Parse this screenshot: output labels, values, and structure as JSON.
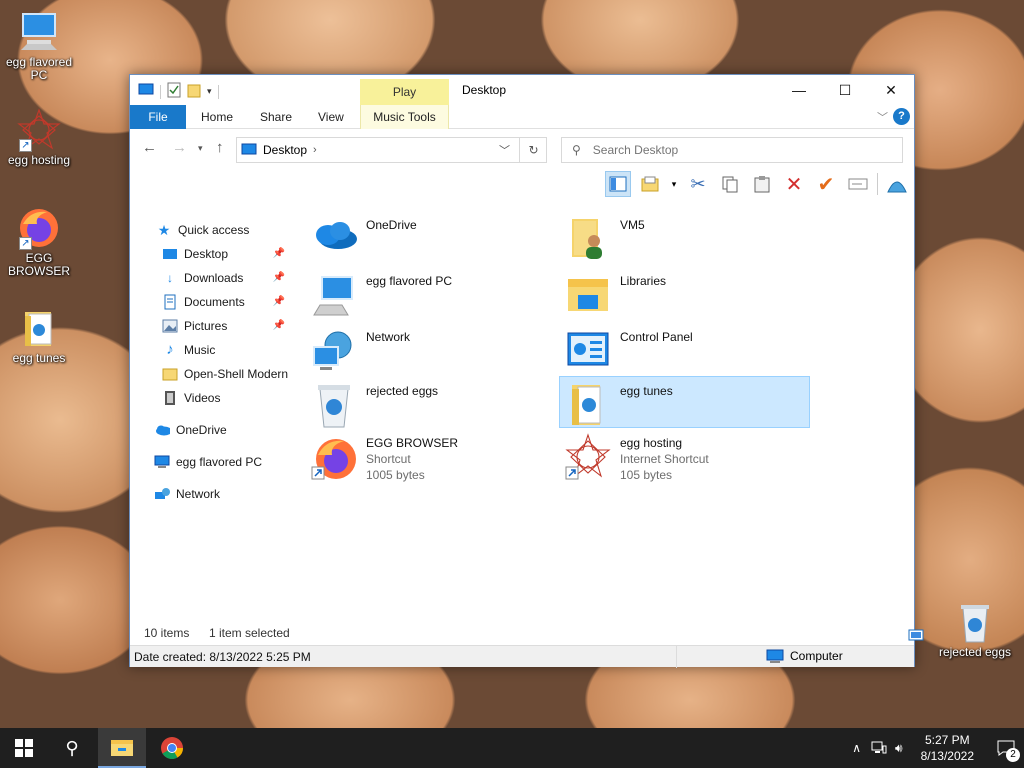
{
  "desktop": {
    "icons": [
      {
        "label": "egg flavored PC",
        "icon": "computer-icon"
      },
      {
        "label": "egg hosting",
        "icon": "web-star-icon"
      },
      {
        "label": "EGG BROWSER",
        "icon": "firefox-icon"
      },
      {
        "label": "egg tunes",
        "icon": "folder-music-icon"
      },
      {
        "label": "rejected eggs",
        "icon": "recycle-bin-icon"
      }
    ]
  },
  "window": {
    "title": "Desktop",
    "context_tab_header": "Play",
    "ribbon_tabs": [
      "File",
      "Home",
      "Share",
      "View",
      "Music Tools"
    ],
    "address": {
      "crumb": "Desktop"
    },
    "search": {
      "placeholder": "Search Desktop"
    },
    "nav_pane": [
      {
        "label": "Quick access",
        "icon": "star-icon"
      },
      {
        "label": "Desktop",
        "icon": "desktop-icon",
        "pinned": true
      },
      {
        "label": "Downloads",
        "icon": "download-icon",
        "pinned": true
      },
      {
        "label": "Documents",
        "icon": "document-icon",
        "pinned": true
      },
      {
        "label": "Pictures",
        "icon": "picture-icon",
        "pinned": true
      },
      {
        "label": "Music",
        "icon": "music-icon"
      },
      {
        "label": "Open-Shell Modern",
        "icon": "folder-icon"
      },
      {
        "label": "Videos",
        "icon": "video-icon"
      },
      {
        "label": "OneDrive",
        "icon": "cloud-icon"
      },
      {
        "label": "egg flavored PC",
        "icon": "computer-icon"
      },
      {
        "label": "Network",
        "icon": "network-icon"
      }
    ],
    "items": [
      {
        "name": "OneDrive",
        "sub1": "",
        "sub2": "",
        "icon": "cloud-icon"
      },
      {
        "name": "VM5",
        "sub1": "",
        "sub2": "",
        "icon": "user-folder-icon"
      },
      {
        "name": "egg flavored PC",
        "sub1": "",
        "sub2": "",
        "icon": "computer-icon"
      },
      {
        "name": "Libraries",
        "sub1": "",
        "sub2": "",
        "icon": "libraries-icon"
      },
      {
        "name": "Network",
        "sub1": "",
        "sub2": "",
        "icon": "network-icon"
      },
      {
        "name": "Control Panel",
        "sub1": "",
        "sub2": "",
        "icon": "control-panel-icon"
      },
      {
        "name": "rejected eggs",
        "sub1": "",
        "sub2": "",
        "icon": "recycle-bin-icon"
      },
      {
        "name": "egg tunes",
        "sub1": "",
        "sub2": "",
        "icon": "folder-music-icon",
        "selected": true
      },
      {
        "name": "EGG BROWSER",
        "sub1": "Shortcut",
        "sub2": "1005 bytes",
        "icon": "firefox-icon"
      },
      {
        "name": "egg hosting",
        "sub1": "Internet Shortcut",
        "sub2": "105 bytes",
        "icon": "web-star-icon"
      }
    ],
    "status": {
      "count": "10 items",
      "selection": "1 item selected"
    },
    "details": {
      "date_created": "Date created: 8/13/2022 5:25 PM",
      "location": "Computer"
    }
  },
  "taskbar": {
    "time": "5:27 PM",
    "date": "8/13/2022",
    "notification_count": "2"
  },
  "colors": {
    "accent": "#1979ca",
    "selection": "#cce8ff",
    "context_tab": "#f8f19a"
  }
}
